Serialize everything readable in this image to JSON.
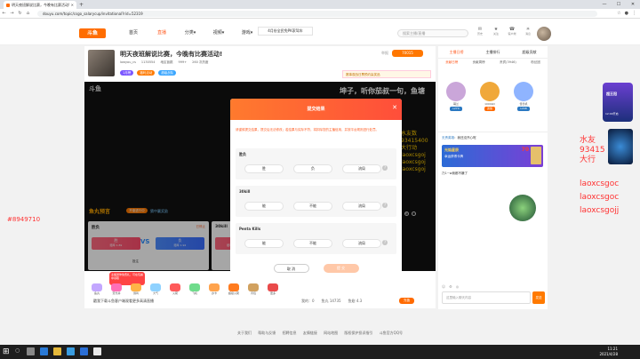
{
  "browser": {
    "tab_title": "明天夜班解说比赛，今晚有比赛活动!",
    "url": "douyu.com/topic/csgo_salarycup/invitational?rid=52319",
    "win_min": "—",
    "win_max": "☐",
    "win_close": "✕"
  },
  "header": {
    "logo": "斗鱼",
    "nav": [
      "首页",
      "直播",
      "分类▾",
      "视频▾",
      "游戏▾",
      "鱼吧"
    ],
    "search_placeholder": "搜索主播/直播",
    "icons": [
      {
        "glyph": "✉",
        "label": "历史"
      },
      {
        "glyph": "★",
        "label": "关注"
      },
      {
        "glyph": "☎",
        "label": "客户端"
      },
      {
        "glyph": "☀",
        "label": "消息"
      },
      {
        "glyph": "✚",
        "label": "开播"
      }
    ],
    "dropdown_ad": "4月份全民免PK家驾车"
  },
  "overlay_left": "#8949710",
  "overlay_right": {
    "l1": "水友",
    "l2": "93415",
    "l3": "大行",
    "l4": "laoxcsgoc",
    "l5": "laoxcsgoc",
    "l6": "laoxcsgojj"
  },
  "overlay_mid": {
    "l1": "水友数",
    "l2": "93415400",
    "l3": "大行动",
    "l4": "laoxcsgoj",
    "l5": "laoxcsgoj",
    "l6": "laoxcsgoj"
  },
  "room": {
    "title": "明天夜班解说比赛，今晚有比赛活动!",
    "meta": [
      "lowyou_cs",
      "1130554",
      "地区盲跳",
      "999+",
      "260 次热度"
    ],
    "badges": [
      {
        "text": "1月榜",
        "color": "#7b57ff"
      },
      {
        "text": "福利活动",
        "color": "#ff7a00"
      },
      {
        "text": "超级战队",
        "color": "#3aa6ff"
      }
    ],
    "report": "举报",
    "follow": "70015",
    "ticket": "赛事观战日票预约赢奖品"
  },
  "player": {
    "logo": "斗鱼",
    "danmu": "坤子，听你茄叔一句，鱼塘",
    "predict_title": "鱼丸预言",
    "predict_badge": "开盘进行中",
    "predict_sub": "猜中赢奖励",
    "card1": {
      "label": "胜负",
      "status": "已停止",
      "opt_a": "胜",
      "opt_a_sub": "赔率 1.89",
      "opt_b": "负",
      "opt_b_sub": "赔率 1.92",
      "vs": "VS",
      "foot": "投注"
    },
    "card2": {
      "label": "30kill",
      "status": "已停止",
      "opt_a": "能",
      "opt_a_sub": "赔率 1.90"
    },
    "controls": [
      "◐",
      "⛶"
    ]
  },
  "giftbar": {
    "promo": "主播送你免费礼，可在包裹中领取",
    "gifts": [
      {
        "label": "鱼丸",
        "color": "#c3a7ff"
      },
      {
        "label": "荧光棒",
        "color": "#ff6fb7"
      },
      {
        "label": "弱鸡",
        "color": "#ffb347"
      },
      {
        "label": "大气",
        "color": "#8fd2ff"
      },
      {
        "label": "火箭",
        "color": "#ff5a5a"
      },
      {
        "label": "飞机",
        "color": "#6fdc8c"
      },
      {
        "label": "办卡",
        "color": "#ffa34d"
      },
      {
        "label": "超级火箭",
        "color": "#ff7b1f"
      },
      {
        "label": "背包",
        "color": "#d1a15f"
      },
      {
        "label": "更多",
        "color": "#e94a4a"
      }
    ],
    "tip": "戳我下载斗鱼客户端观看更多高清直播",
    "stats": [
      "我的：0",
      "鱼丸 14735",
      "鱼翅 4.3"
    ],
    "recharge": "充值"
  },
  "rightpanel": {
    "tabs": [
      "主播日榜",
      "主播排行",
      "超级贡献"
    ],
    "sub": [
      "贡献日榜",
      "贡献周榜",
      "贵宾(3946)",
      "粉丝团"
    ],
    "rankers": [
      {
        "name": "萌兰",
        "tag": "LV70",
        "tag_color": "#2b79c2",
        "pic": "#caa6d9"
      },
      {
        "name": "1000kill",
        "tag": "贵族",
        "tag_color": "#ff6a00",
        "pic": "#f0a83a"
      },
      {
        "name": "怪兽机",
        "tag": "LV48",
        "tag_color": "#2b79c2",
        "pic": "#8fb4ff"
      }
    ],
    "chat1_user": "无责英雄",
    "chat1_text": "我还没开心呢",
    "event_t1": "光焰星辰",
    "event_t2": "幸运获得卡牌",
    "event_t3": "70",
    "chat2": "乃1~w我都不嫌了",
    "tools": [
      "☺",
      "⚙",
      "◎"
    ],
    "input_placeholder": "这里输入聊天内容",
    "send": "发送"
  },
  "side": {
    "badge_title": "超王冠",
    "badge_time": "12:00开启"
  },
  "modal": {
    "title": "提交结果",
    "close": "✕",
    "desc": "请谨慎提交结果，提交后无法修改；若结果与实际不符，将扣除您的主播信用，并按平台规则进行处罚。",
    "questions": [
      {
        "title": "胜负",
        "choices": [
          "胜",
          "负",
          "流局"
        ]
      },
      {
        "title": "30kill",
        "choices": [
          "能",
          "不能",
          "流局"
        ]
      },
      {
        "title": "Penta Kills",
        "choices": [
          "能",
          "不能",
          "流局"
        ]
      }
    ],
    "help": "?",
    "cancel": "取 消",
    "submit": "提 交"
  },
  "footer": [
    "关于我们",
    "帮助与反馈",
    "招聘信息",
    "友情链接",
    "网站地图",
    "版权保护投诉指引",
    "斗鱼官方QQ号"
  ],
  "taskbar": {
    "time": "11:21",
    "date": "2021/4/28"
  }
}
